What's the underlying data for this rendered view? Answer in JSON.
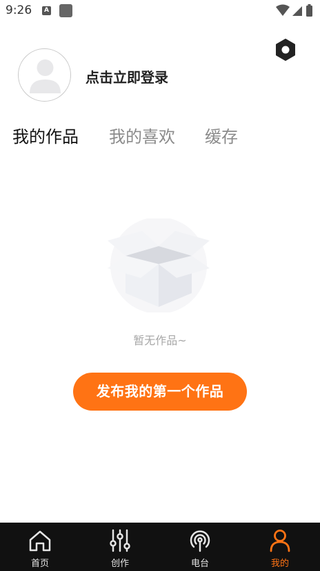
{
  "status_bar": {
    "time": "9:26",
    "notification_letter": "A"
  },
  "profile": {
    "login_prompt": "点击立即登录"
  },
  "tabs": [
    {
      "label": "我的作品",
      "active": true
    },
    {
      "label": "我的喜欢",
      "active": false
    },
    {
      "label": "缓存",
      "active": false
    }
  ],
  "empty_state": {
    "message": "暂无作品~",
    "action_label": "发布我的第一个作品"
  },
  "bottom_nav": [
    {
      "label": "首页",
      "icon": "home-icon",
      "active": false
    },
    {
      "label": "创作",
      "icon": "sliders-icon",
      "active": false
    },
    {
      "label": "电台",
      "icon": "radio-icon",
      "active": false
    },
    {
      "label": "我的",
      "icon": "person-icon",
      "active": true
    }
  ],
  "colors": {
    "accent": "#ff7314",
    "nav_background": "#111111",
    "text_primary": "#111111",
    "text_secondary": "#8b8b8b"
  }
}
